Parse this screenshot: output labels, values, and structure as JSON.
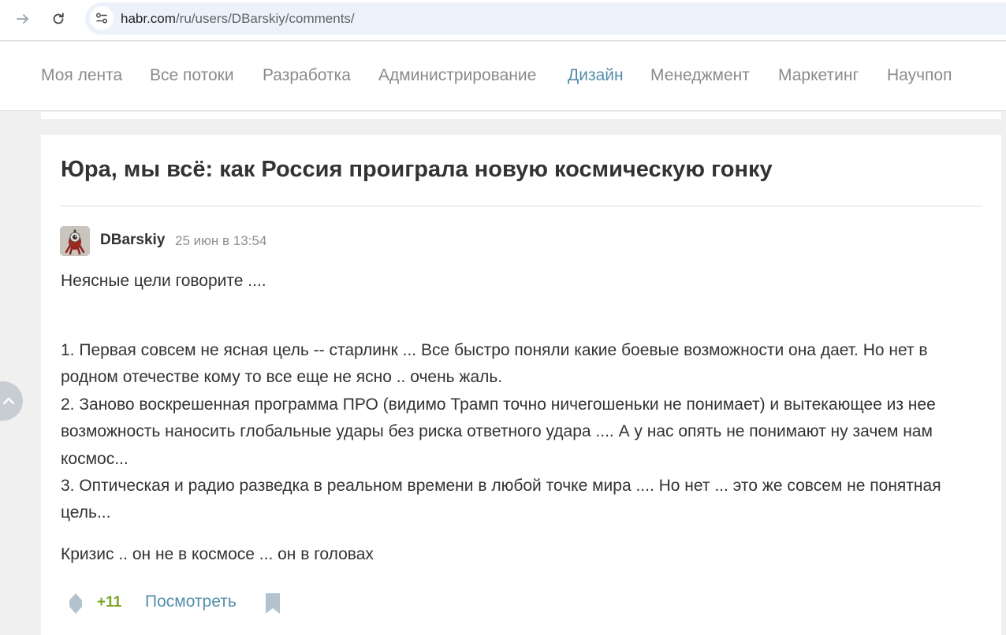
{
  "browser": {
    "url_host": "habr.com",
    "url_path": "/ru/users/DBarskiy/comments/"
  },
  "nav": {
    "items": [
      {
        "label": "Моя лента"
      },
      {
        "label": "Все потоки"
      },
      {
        "label": "Разработка"
      },
      {
        "label": "Администрирование"
      },
      {
        "label": "Дизайн",
        "active": true
      },
      {
        "label": "Менеджмент"
      },
      {
        "label": "Маркетинг"
      },
      {
        "label": "Научпоп"
      }
    ]
  },
  "post": {
    "title": "Юра, мы всё: как Россия проиграла новую космическую гонку"
  },
  "comment": {
    "author": "DBarskiy",
    "timestamp": "25 июн в 13:54",
    "paragraph_1": "Неясные цели говорите ....",
    "list": [
      "1. Первая совсем не ясная цель -- старлинк ... Все быстро поняли какие боевые возможности она дает. Но нет в родном отечестве кому то все еще не ясно .. очень жаль.",
      "2. Заново воскрешенная программа ПРО (видимо Трамп точно ничегошеньки не понимает) и вытекающее из нее возможность наносить глобальные удары без риска ответного удара .... А у нас опять не понимают ну зачем нам космос...",
      "3. Оптическая и радио разведка в реальном времени в любой точке мира .... Но нет ... это же совсем не понятная цель..."
    ],
    "paragraph_2": "Кризис .. он не в космосе ... он в головах",
    "score": "+11",
    "view_label": "Посмотреть"
  },
  "colors": {
    "accent": "#548eaa",
    "score_positive": "#7ba428",
    "icon_gray": "#b3c2cc"
  },
  "icons": {
    "forward": "arrow-right-icon",
    "reload": "reload-icon",
    "site_info": "tune-icon",
    "vote": "diamond-icon",
    "bookmark": "bookmark-icon",
    "scroll_up": "chevron-up-icon"
  }
}
